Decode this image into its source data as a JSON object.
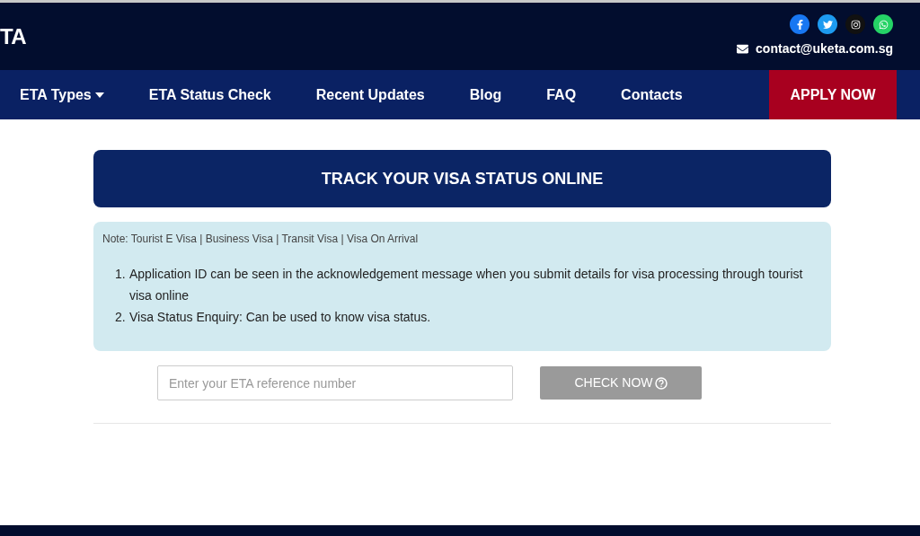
{
  "header": {
    "logo": "TA",
    "email": "contact@uketa.com.sg"
  },
  "nav": {
    "items": [
      {
        "label": "ETA Types",
        "has_menu": true
      },
      {
        "label": "ETA Status Check",
        "has_menu": false
      },
      {
        "label": "Recent Updates",
        "has_menu": false
      },
      {
        "label": "Blog",
        "has_menu": false
      },
      {
        "label": "FAQ",
        "has_menu": false
      },
      {
        "label": "Contacts",
        "has_menu": false
      }
    ],
    "cta": "APPLY NOW"
  },
  "title": "TRACK YOUR VISA STATUS ONLINE",
  "note": {
    "text": "Note: Tourist E Visa | Business Visa | Transit Visa | Visa On Arrival",
    "items": [
      {
        "number": "1.",
        "text": "Application ID can be seen in the acknowledgement message when you submit details for visa processing through tourist visa online"
      },
      {
        "number": "2.",
        "text": "Visa Status Enquiry: Can be used to know visa status."
      }
    ]
  },
  "form": {
    "placeholder": "Enter your ETA reference number",
    "button": "CHECK NOW"
  }
}
